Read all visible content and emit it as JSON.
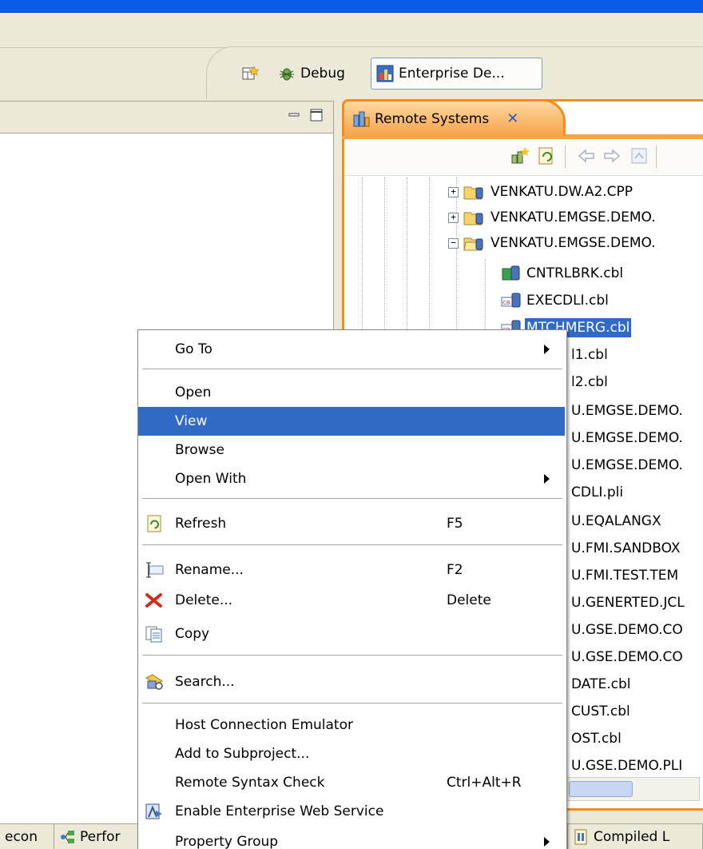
{
  "colors": {
    "title_bar": "#0a5be7",
    "selection": "#316ac5",
    "remote_tab_accent": "#f28c1e"
  },
  "toolbar": {
    "perspectives": [
      {
        "label": "",
        "icon": "open-perspective-icon"
      },
      {
        "label": "Debug",
        "icon": "debug-bug-icon"
      },
      {
        "label": "Enterprise De...",
        "icon": "enterprise-developer-icon"
      }
    ]
  },
  "remote_systems": {
    "tab_label": "Remote Systems",
    "tree": [
      {
        "label": "VENKATU.DW.A2.CPP",
        "kind": "folder",
        "expander": "+"
      },
      {
        "label": "VENKATU.EMGSE.DEMO.",
        "kind": "folder",
        "expander": "+"
      },
      {
        "label": "VENKATU.EMGSE.DEMO.",
        "kind": "folder-open",
        "expander": "−"
      },
      {
        "label": "CNTRLBRK.cbl",
        "kind": "file-green"
      },
      {
        "label": "EXECDLI.cbl",
        "kind": "file-cbl"
      },
      {
        "label": "MTCHMERG.cbl",
        "kind": "file-cbl",
        "selected": true
      },
      {
        "label": "l1.cbl"
      },
      {
        "label": "l2.cbl"
      },
      {
        "label": "U.EMGSE.DEMO."
      },
      {
        "label": "U.EMGSE.DEMO."
      },
      {
        "label": "U.EMGSE.DEMO."
      },
      {
        "label": "CDLI.pli"
      },
      {
        "label": "U.EQALANGX"
      },
      {
        "label": "U.FMI.SANDBOX"
      },
      {
        "label": "U.FMI.TEST.TEM"
      },
      {
        "label": "U.GENERTED.JCL"
      },
      {
        "label": "U.GSE.DEMO.CO"
      },
      {
        "label": "U.GSE.DEMO.CO"
      },
      {
        "label": "DATE.cbl"
      },
      {
        "label": "CUST.cbl"
      },
      {
        "label": "OST.cbl"
      },
      {
        "label": "U.GSE.DEMO.PLI"
      }
    ]
  },
  "bottom_tabs": [
    {
      "label": "econ",
      "icon": ""
    },
    {
      "label": "Perfor",
      "icon": "performance-icon"
    },
    {
      "label": "Compiled L",
      "icon": "compiled-listing-icon"
    }
  ],
  "context_menu": {
    "items": [
      {
        "label": "Go To",
        "accel": "",
        "submenu": true,
        "icon": ""
      },
      {
        "label": "Open",
        "accel": "",
        "submenu": false,
        "icon": ""
      },
      {
        "label": "View",
        "accel": "",
        "submenu": false,
        "icon": "",
        "highlighted": true
      },
      {
        "label": "Browse",
        "accel": "",
        "submenu": false,
        "icon": ""
      },
      {
        "label": "Open With",
        "accel": "",
        "submenu": true,
        "icon": ""
      },
      {
        "label": "Refresh",
        "accel": "F5",
        "submenu": false,
        "icon": "refresh-icon"
      },
      {
        "label": "Rename...",
        "accel": "F2",
        "submenu": false,
        "icon": "rename-icon"
      },
      {
        "label": "Delete...",
        "accel": "Delete",
        "submenu": false,
        "icon": "delete-icon"
      },
      {
        "label": "Copy",
        "accel": "",
        "submenu": false,
        "icon": "copy-icon"
      },
      {
        "label": "Search...",
        "accel": "",
        "submenu": false,
        "icon": "search-icon"
      },
      {
        "label": "Host Connection Emulator",
        "accel": "",
        "submenu": false,
        "icon": ""
      },
      {
        "label": "Add to Subproject...",
        "accel": "",
        "submenu": false,
        "icon": ""
      },
      {
        "label": "Remote Syntax Check",
        "accel": "Ctrl+Alt+R",
        "submenu": false,
        "icon": ""
      },
      {
        "label": "Enable Enterprise Web Service",
        "accel": "",
        "submenu": false,
        "icon": "web-service-icon"
      },
      {
        "label": "Property Group",
        "accel": "",
        "submenu": true,
        "icon": ""
      }
    ]
  }
}
